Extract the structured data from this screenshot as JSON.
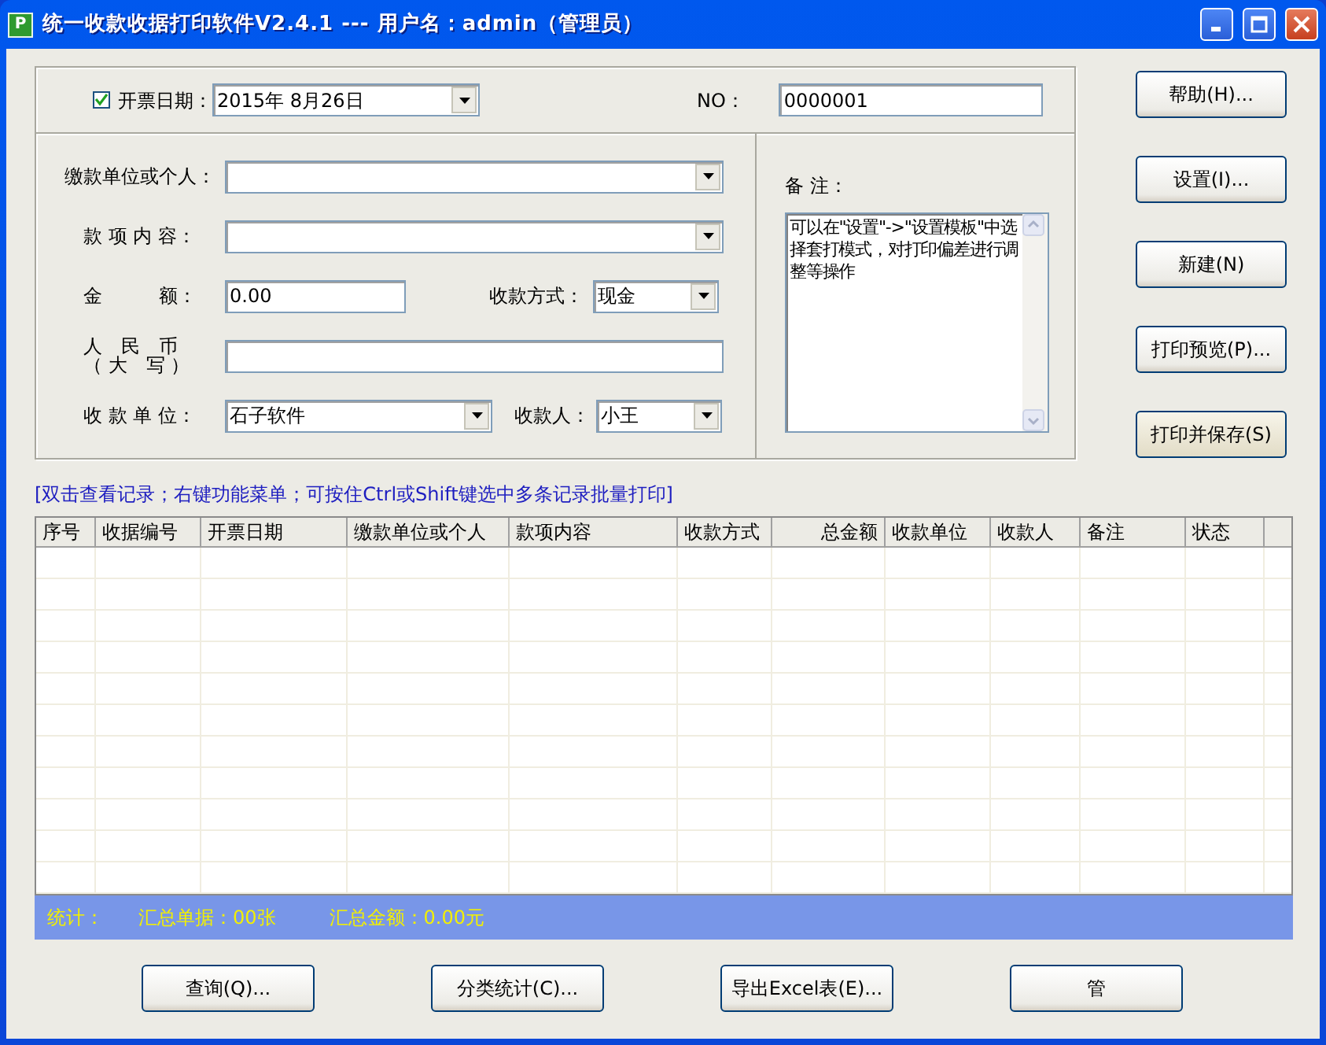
{
  "window": {
    "title": "统一收款收据打印软件V2.4.1 --- 用户名：admin（管理员）",
    "app_icon_letter": "P"
  },
  "invoice_date": {
    "label": "开票日期：",
    "checked": true,
    "value": "2015年  8月26日"
  },
  "number": {
    "label": "NO：",
    "value": "0000001"
  },
  "form": {
    "payer": {
      "label": "缴款单位或个人："
    },
    "item": {
      "label": "款 项 内 容："
    },
    "amount": {
      "label": "金　　　额：",
      "value": "0.00"
    },
    "payment_method": {
      "label": "收款方式：",
      "value": "现金"
    },
    "amount_in_words": {
      "label_lines": [
        "人　民　币",
        "（ 大　写 ）"
      ]
    },
    "receiving_unit": {
      "label": "收 款 单 位：",
      "value": "石子软件"
    },
    "payee": {
      "label": "收款人：",
      "value": "小王"
    }
  },
  "remark": {
    "label": "备 注：",
    "value": "可以在\"设置\"->\"设置模板\"中选择套打模式，对打印偏差进行调整等操作"
  },
  "side_buttons": [
    {
      "label": "帮助(H)...",
      "default": false
    },
    {
      "label": "设置(I)...",
      "default": false
    },
    {
      "label": "新建(N)",
      "default": false
    },
    {
      "label": "打印预览(P)...",
      "default": false
    },
    {
      "label": "打印并保存(S)",
      "default": true
    }
  ],
  "hint": "[双击查看记录；右键功能菜单；可按住Ctrl或Shift键选中多条记录批量打印]",
  "table": {
    "columns": [
      "序号",
      "收据编号",
      "开票日期",
      "缴款单位或个人",
      "款项内容",
      "收款方式",
      "总金额",
      "收款单位",
      "收款人",
      "备注",
      "状态"
    ]
  },
  "stats": {
    "label": "统计：",
    "count": "汇总单据：00张",
    "total": "汇总金额：0.00元"
  },
  "bottom_buttons": [
    "查询(Q)...",
    "分类统计(C)...",
    "导出Excel表(E)...",
    "管"
  ]
}
